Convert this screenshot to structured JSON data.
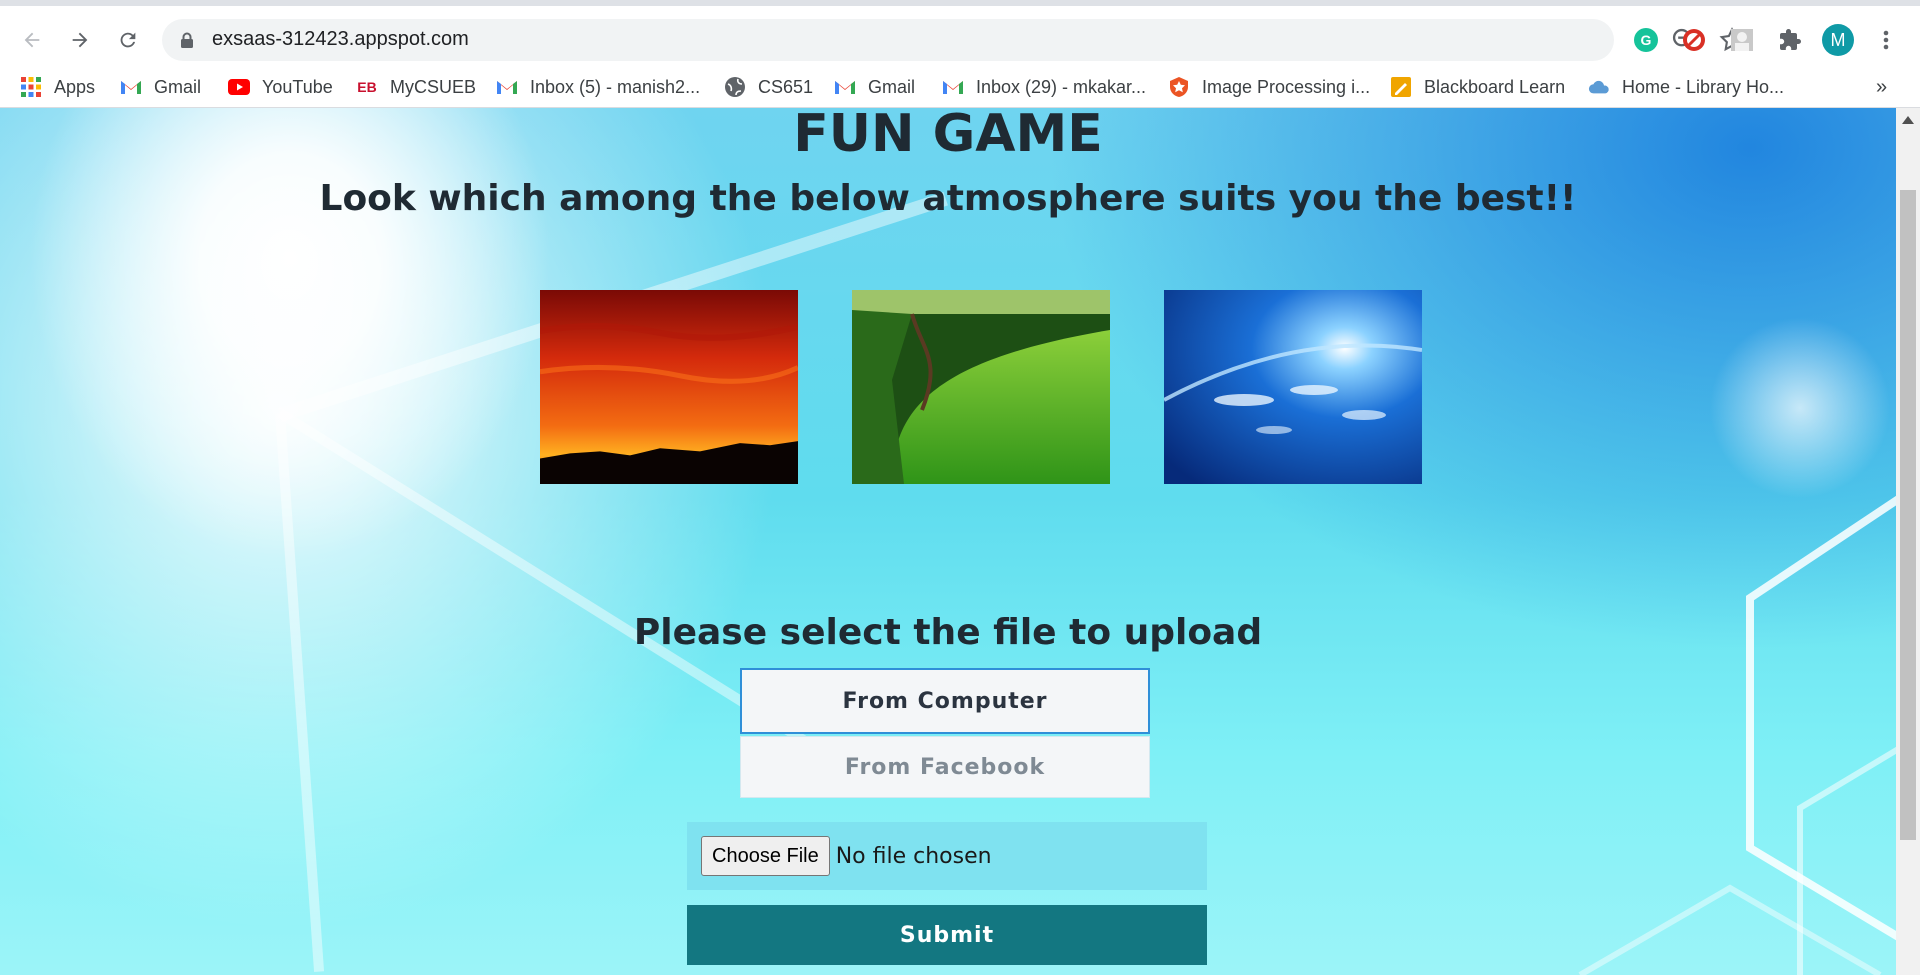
{
  "browser": {
    "url": "exsaas-312423.appspot.com",
    "profile_initial": "M",
    "bookmarks": [
      {
        "label": "Apps",
        "icon": "apps-grid-icon"
      },
      {
        "label": "Gmail",
        "icon": "gmail-icon"
      },
      {
        "label": "YouTube",
        "icon": "youtube-icon"
      },
      {
        "label": "MyCSUEB",
        "icon": "eb-icon"
      },
      {
        "label": "Inbox (5) - manish2...",
        "icon": "gmail-icon"
      },
      {
        "label": "CS651",
        "icon": "globe-icon"
      },
      {
        "label": "Gmail",
        "icon": "gmail-icon"
      },
      {
        "label": "Inbox (29) - mkakar...",
        "icon": "gmail-icon"
      },
      {
        "label": "Image Processing i...",
        "icon": "shield-icon"
      },
      {
        "label": "Blackboard Learn",
        "icon": "blackboard-icon"
      },
      {
        "label": "Home - Library Ho...",
        "icon": "cloud-icon"
      }
    ],
    "more_bookmarks": "»"
  },
  "page": {
    "title": "FUN GAME",
    "subtitle": "Look which among the below atmosphere suits you the best!!",
    "images": [
      "sunset-image",
      "green-lawn-image",
      "earth-atmosphere-image"
    ],
    "upload_heading": "Please select the file to upload",
    "from_computer": "From Computer",
    "from_facebook": "From Facebook",
    "choose_file": "Choose File",
    "file_status": "No file chosen",
    "submit": "Submit"
  },
  "colors": {
    "submit_bg": "#137781",
    "file_row_bg": "#7fe2f0",
    "selected_border": "#2f8fd8",
    "title_color": "#1f2a33"
  }
}
